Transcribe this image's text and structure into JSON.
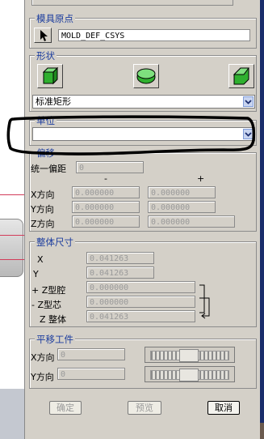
{
  "top_section": {
    "title": "模具原点",
    "csys_value": "MOLD_DEF_CSYS"
  },
  "shape": {
    "title": "形状",
    "selected": "标准矩形"
  },
  "units": {
    "title": "单位",
    "selected": ""
  },
  "offset": {
    "title": "偏移",
    "uniform_label": "统一偏距",
    "uniform_value": "0",
    "minus_header": "-",
    "plus_header": "+",
    "rows": [
      {
        "label": "X方向",
        "minus": "0.000000",
        "plus": "0.000000"
      },
      {
        "label": "Y方向",
        "minus": "0.000000",
        "plus": "0.000000"
      },
      {
        "label": "Z方向",
        "minus": "0.000000",
        "plus": "0.000000"
      }
    ]
  },
  "overall": {
    "title": "整体尺寸",
    "rows": [
      {
        "label": "X",
        "value": "0.041263"
      },
      {
        "label": "Y",
        "value": "0.041263"
      },
      {
        "label": "+ Z型腔",
        "value": "0.000000"
      },
      {
        "label": "- Z型芯",
        "value": "0.000000"
      },
      {
        "label": "Z 整体",
        "value": "0.041263"
      }
    ]
  },
  "translate": {
    "title": "平移工件",
    "x_label": "X方向",
    "x_value": "0",
    "y_label": "Y方向",
    "y_value": "0"
  },
  "buttons": {
    "ok": "确定",
    "preview": "预览",
    "cancel": "取消"
  },
  "colors": {
    "section_title": "#1c3d9e",
    "dialog_bg": "#d4d0c8",
    "annotation": "#000000"
  }
}
